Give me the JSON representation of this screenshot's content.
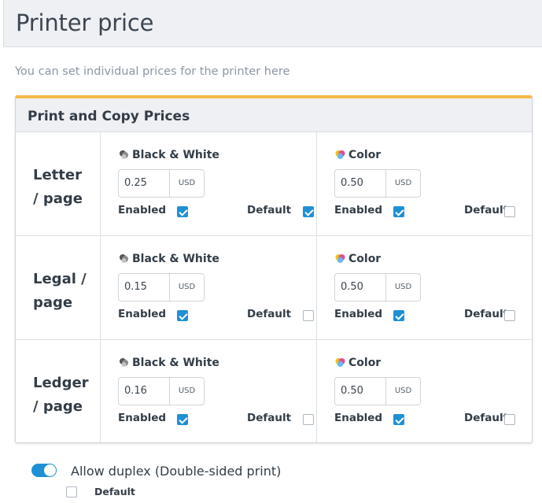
{
  "page": {
    "title": "Printer price",
    "subtitle": "You can set individual prices for the printer here"
  },
  "card": {
    "title": "Print and Copy Prices"
  },
  "labels": {
    "black_white": "Black & White",
    "color": "Color",
    "enabled": "Enabled",
    "default": "Default",
    "currency": "USD"
  },
  "icons": {
    "black_white": "bw-toner-icon",
    "color": "color-toner-icon"
  },
  "colors": {
    "accent": "#1e90d6",
    "card_top_border": "#f5b94a"
  },
  "rows": [
    {
      "paper": "Letter / page",
      "bw": {
        "price": "0.25",
        "enabled": true,
        "default": true
      },
      "color": {
        "price": "0.50",
        "enabled": true,
        "default": false
      }
    },
    {
      "paper": "Legal / page",
      "bw": {
        "price": "0.15",
        "enabled": true,
        "default": false
      },
      "color": {
        "price": "0.50",
        "enabled": true,
        "default": false
      }
    },
    {
      "paper": "Ledger / page",
      "bw": {
        "price": "0.16",
        "enabled": true,
        "default": false
      },
      "color": {
        "price": "0.50",
        "enabled": true,
        "default": false
      }
    }
  ],
  "duplex": {
    "label": "Allow duplex (Double-sided print)",
    "enabled": true,
    "default_label": "Default",
    "default": false
  }
}
